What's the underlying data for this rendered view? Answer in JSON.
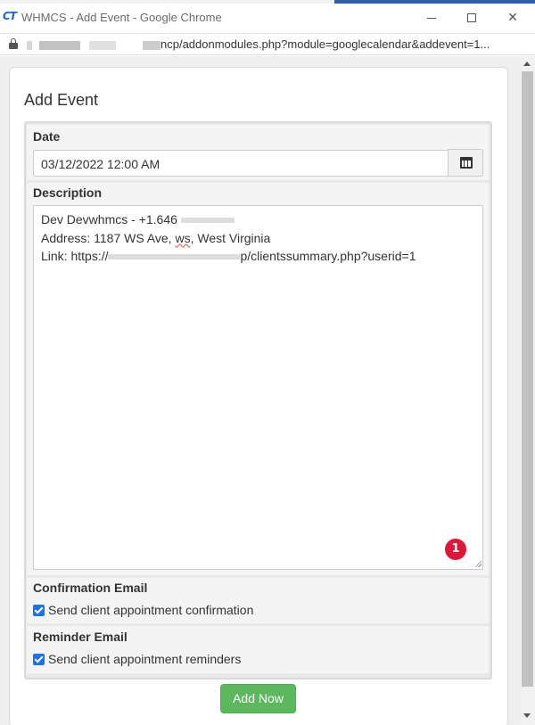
{
  "window": {
    "app_logo": "CT",
    "title": "WHMCS - Add Event - Google Chrome",
    "url": "/admin/addonmodules.php?module=googlecalendar&addevent=1..."
  },
  "url_visible": "ncp/addonmodules.php?module=googlecalendar&addevent=1...",
  "panel": {
    "title": "Add Event"
  },
  "form": {
    "date": {
      "label": "Date",
      "value": "03/12/2022 12:00 AM",
      "calendar_icon": "calendar-icon"
    },
    "description": {
      "label": "Description",
      "line1_prefix": "Dev Devwhmcs - +1.646",
      "line2_prefix": "Address: 1187 WS Ave, ",
      "line2_spell": "ws",
      "line2_suffix": ", West Virginia",
      "line3_prefix": "Link: https://",
      "line3_suffix": "p/clientssummary.php?userid=1",
      "badge_count": "1"
    },
    "confirmation": {
      "label": "Confirmation Email",
      "checkbox_label": "Send client appointment confirmation",
      "checked": true
    },
    "reminder": {
      "label": "Reminder Email",
      "checkbox_label": "Send client appointment reminders",
      "checked": true
    },
    "submit_label": "Add Now"
  },
  "colors": {
    "submit_green": "#5cb85c",
    "badge_red": "#e0173b",
    "checkbox_blue": "#1a73e8"
  }
}
